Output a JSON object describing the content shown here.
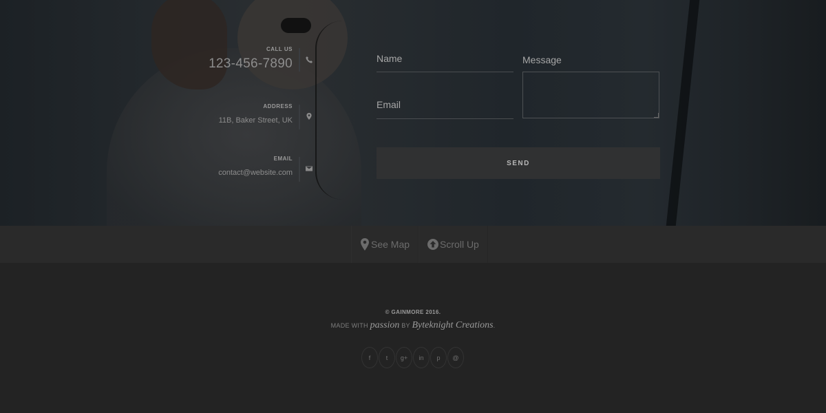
{
  "contact": {
    "call_label": "CALL US",
    "phone": "123-456-7890",
    "address_label": "ADDRESS",
    "address": "11B, Baker Street, UK",
    "email_label": "EMAIL",
    "email": "contact@website.com"
  },
  "form": {
    "name_label": "Name",
    "email_label": "Email",
    "message_label": "Message",
    "send_label": "SEND"
  },
  "actions": {
    "map_label": "See Map",
    "scroll_label": "Scroll Up"
  },
  "footer": {
    "copyright": "© GAINMORE 2016.",
    "made_with": "MADE WITH",
    "passion": "passion",
    "by": "BY",
    "author": "Byteknight Creations",
    "period": "."
  },
  "social": [
    {
      "name": "facebook-icon",
      "glyph": "f"
    },
    {
      "name": "twitter-icon",
      "glyph": "t"
    },
    {
      "name": "google-plus-icon",
      "glyph": "g+"
    },
    {
      "name": "linkedin-icon",
      "glyph": "in"
    },
    {
      "name": "pinterest-icon",
      "glyph": "p"
    },
    {
      "name": "email-icon",
      "glyph": "@"
    }
  ]
}
